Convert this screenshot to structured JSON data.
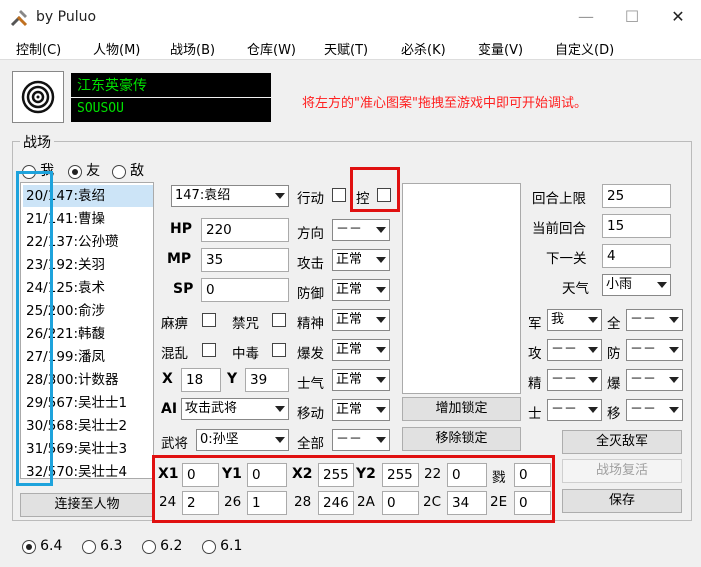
{
  "window": {
    "title": "by Puluo",
    "min": "—",
    "max": "☐",
    "close": "✕"
  },
  "menu": [
    "控制(C)",
    "人物(M)",
    "战场(B)",
    "仓库(W)",
    "天赋(T)",
    "必杀(K)",
    "变量(V)",
    "自定义(D)"
  ],
  "header": {
    "game_name": "江东英豪传",
    "game_code": "SOUSOU",
    "hint": "将左方的\"准心图案\"拖拽至游戏中即可开始调试。"
  },
  "group": {
    "label": "战场"
  },
  "side_filter": {
    "options": [
      {
        "label": "我",
        "checked": false
      },
      {
        "label": "友",
        "checked": true
      },
      {
        "label": "敌",
        "checked": false
      }
    ]
  },
  "roster": {
    "selected_index": 0,
    "items": [
      "20/147:袁绍",
      "21/141:曹操",
      "22/137:公孙瓒",
      "23/192:关羽",
      "24/125:袁术",
      "25/200:俞涉",
      "26/221:韩馥",
      "27/199:潘凤",
      "28/300:计数器",
      "29/567:吴壮士1",
      "30/568:吴壮士2",
      "31/569:吴壮士3",
      "32/570:吴壮士4"
    ]
  },
  "unit": {
    "select": "147:袁绍",
    "hp": {
      "label": "HP",
      "value": "220"
    },
    "mp": {
      "label": "MP",
      "value": "35"
    },
    "sp": {
      "label": "SP",
      "value": "0"
    },
    "paralyze": "麻痹",
    "seal": "禁咒",
    "confuse": "混乱",
    "poison": "中毒",
    "x": {
      "label": "X",
      "value": "18"
    },
    "y": {
      "label": "Y",
      "value": "39"
    },
    "ai": {
      "label": "AI",
      "value": "攻击武将"
    },
    "general": {
      "label": "武将",
      "value": "0:孙坚"
    }
  },
  "status": {
    "action": "行动",
    "control": "控",
    "direction": {
      "label": "方向",
      "value": "－－"
    },
    "attack": {
      "label": "攻击",
      "value": "正常"
    },
    "defense": {
      "label": "防御",
      "value": "正常"
    },
    "spirit": {
      "label": "精神",
      "value": "正常"
    },
    "burst": {
      "label": "爆发",
      "value": "正常"
    },
    "morale": {
      "label": "士气",
      "value": "正常"
    },
    "move": {
      "label": "移动",
      "value": "正常"
    },
    "all": {
      "label": "全部",
      "value": "－－"
    }
  },
  "lock": {
    "add": "增加锁定",
    "remove": "移除锁定"
  },
  "battle": {
    "round_limit": {
      "label": "回合上限",
      "value": "25"
    },
    "current_round": {
      "label": "当前回合",
      "value": "15"
    },
    "next_stage": {
      "label": "下一关",
      "value": "4"
    },
    "weather": {
      "label": "天气",
      "value": "小雨"
    }
  },
  "army": {
    "army": {
      "label": "军",
      "value": "我"
    },
    "all": {
      "label": "全",
      "value": "－－"
    },
    "atk": {
      "label": "攻",
      "value": "－－"
    },
    "def": {
      "label": "防",
      "value": "－－"
    },
    "spi": {
      "label": "精",
      "value": "－－"
    },
    "bur": {
      "label": "爆",
      "value": "－－"
    },
    "mor": {
      "label": "士",
      "value": "－－"
    },
    "mov": {
      "label": "移",
      "value": "－－"
    }
  },
  "actions": {
    "kill_all": "全灭敌军",
    "revive": "战场复活",
    "save": "保存"
  },
  "vars_row1": [
    {
      "label": "X1",
      "value": "0",
      "bold": true
    },
    {
      "label": "Y1",
      "value": "0",
      "bold": true
    },
    {
      "label": "X2",
      "value": "255",
      "bold": true
    },
    {
      "label": "Y2",
      "value": "255",
      "bold": true
    },
    {
      "label": "22",
      "value": "0",
      "bold": false
    },
    {
      "label": "戮",
      "value": "0",
      "bold": false
    }
  ],
  "vars_row2": [
    {
      "label": "24",
      "value": "2"
    },
    {
      "label": "26",
      "value": "1"
    },
    {
      "label": "28",
      "value": "246"
    },
    {
      "label": "2A",
      "value": "0"
    },
    {
      "label": "2C",
      "value": "34"
    },
    {
      "label": "2E",
      "value": "0"
    }
  ],
  "connect": "连接至人物",
  "versions": [
    {
      "label": "6.4",
      "checked": true
    },
    {
      "label": "6.3",
      "checked": false
    },
    {
      "label": "6.2",
      "checked": false
    },
    {
      "label": "6.1",
      "checked": false
    }
  ]
}
